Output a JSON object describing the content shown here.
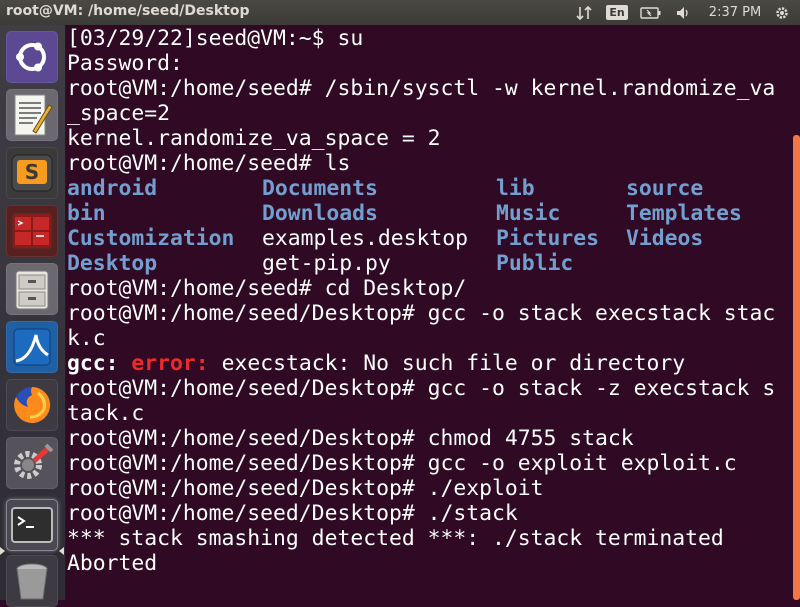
{
  "window": {
    "title": "root@VM: /home/seed/Desktop"
  },
  "panel": {
    "lang": "En",
    "clock": "2:37 PM"
  },
  "launcher": {
    "items": [
      {
        "name": "ubuntu-dash-icon"
      },
      {
        "name": "text-editor-icon"
      },
      {
        "name": "sublime-text-icon"
      },
      {
        "name": "terminator-icon"
      },
      {
        "name": "file-manager-icon"
      },
      {
        "name": "wireshark-icon"
      },
      {
        "name": "firefox-icon"
      },
      {
        "name": "system-settings-icon"
      },
      {
        "name": "terminal-icon"
      },
      {
        "name": "trash-icon"
      }
    ]
  },
  "terminal": {
    "lines_top": [
      "[03/29/22]seed@VM:~$ su",
      "Password:",
      "root@VM:/home/seed# /sbin/sysctl -w kernel.randomize_va",
      "_space=2",
      "kernel.randomize_va_space = 2",
      "root@VM:/home/seed# ls"
    ],
    "ls_rows": [
      [
        {
          "t": "android",
          "dir": true
        },
        {
          "t": "Documents",
          "dir": true
        },
        {
          "t": "lib",
          "dir": true
        },
        {
          "t": "source",
          "dir": true
        }
      ],
      [
        {
          "t": "bin",
          "dir": true
        },
        {
          "t": "Downloads",
          "dir": true
        },
        {
          "t": "Music",
          "dir": true
        },
        {
          "t": "Templates",
          "dir": true
        }
      ],
      [
        {
          "t": "Customization",
          "dir": true
        },
        {
          "t": "examples.desktop",
          "dir": false
        },
        {
          "t": "Pictures",
          "dir": true
        },
        {
          "t": "Videos",
          "dir": true
        }
      ],
      [
        {
          "t": "Desktop",
          "dir": true
        },
        {
          "t": "get-pip.py",
          "dir": false
        },
        {
          "t": "Public",
          "dir": true
        },
        {
          "t": "",
          "dir": false
        }
      ]
    ],
    "lines_mid": [
      "root@VM:/home/seed# cd Desktop/",
      "root@VM:/home/seed/Desktop# gcc -o stack execstack stac",
      "k.c"
    ],
    "gcc_error": {
      "prog": "gcc:",
      "label": "error:",
      "msg": " execstack: No such file or directory"
    },
    "lines_bottom": [
      "root@VM:/home/seed/Desktop# gcc -o stack -z execstack s",
      "tack.c",
      "root@VM:/home/seed/Desktop# chmod 4755 stack",
      "root@VM:/home/seed/Desktop# gcc -o exploit exploit.c",
      "root@VM:/home/seed/Desktop# ./exploit",
      "root@VM:/home/seed/Desktop# ./stack",
      "*** stack smashing detected ***: ./stack terminated",
      "Aborted"
    ]
  },
  "colors": {
    "terminal_bg": "#300a24",
    "directory": "#729fcf",
    "error": "#ef2929",
    "scroll_thumb": "#f07746"
  }
}
